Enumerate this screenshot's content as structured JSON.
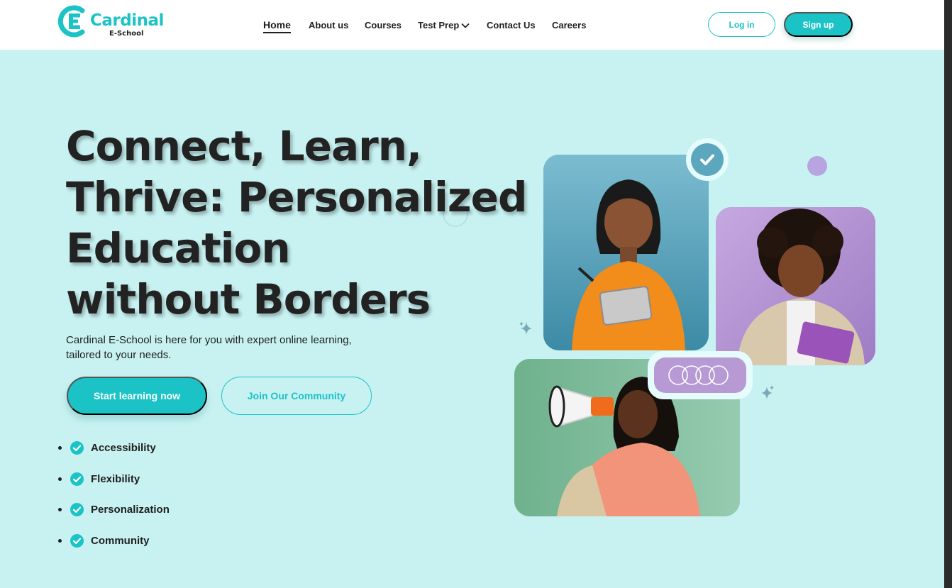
{
  "brand": {
    "name": "Cardinal",
    "subtitle": "E-School",
    "color": "#1cc3c6"
  },
  "nav": {
    "items": [
      {
        "label": "Home",
        "active": true
      },
      {
        "label": "About us"
      },
      {
        "label": "Courses"
      },
      {
        "label": "Test Prep",
        "dropdown": true
      },
      {
        "label": "Contact Us"
      },
      {
        "label": "Careers"
      }
    ]
  },
  "auth": {
    "login_label": "Log in",
    "signup_label": "Sign up"
  },
  "hero": {
    "title_lines": [
      "Connect, Learn,",
      "Thrive: Personalized",
      "Education",
      "without Borders"
    ],
    "subtitle": "Cardinal E-School is here for you with expert online learning, tailored to your needs.",
    "primary_cta": "Start learning now",
    "secondary_cta": "Join Our Community"
  },
  "features": [
    "Accessibility",
    "Flexibility",
    "Personalization",
    "Community"
  ],
  "icons": {
    "logo": "logo-icon",
    "dropdown": "chevron-down-icon",
    "check": "check-circle-icon",
    "sparkle": "sparkle-icon",
    "rings": "rings-icon"
  },
  "colors": {
    "background": "#c8f2f2",
    "accent": "#1cc3c6",
    "heading": "#222222",
    "purple": "#b8a4df"
  }
}
